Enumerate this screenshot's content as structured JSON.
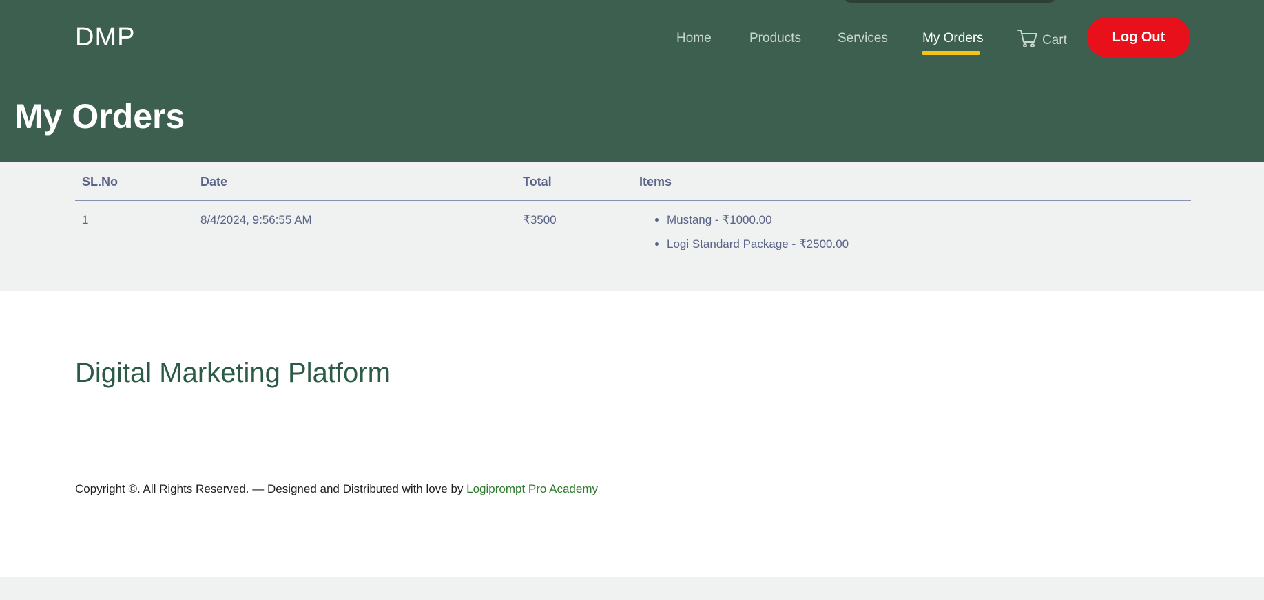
{
  "header": {
    "brand": "DMP",
    "nav": {
      "home": "Home",
      "products": "Products",
      "services": "Services",
      "my_orders": "My Orders",
      "cart": "Cart"
    },
    "logout_label": "Log Out",
    "page_title": "My Orders",
    "colors": {
      "background": "#3d5f50",
      "active_underline": "#f5c315",
      "logout": "#e8101a"
    }
  },
  "orders": {
    "columns": {
      "sl": "SL.No",
      "date": "Date",
      "total": "Total",
      "items": "Items"
    },
    "rows": [
      {
        "sl": "1",
        "date": "8/4/2024, 9:56:55 AM",
        "total": "₹3500",
        "items": [
          "Mustang - ₹1000.00",
          "Logi Standard Package - ₹2500.00"
        ]
      }
    ]
  },
  "footer": {
    "title": "Digital Marketing Platform",
    "copyright_prefix": "Copyright ©. All Rights Reserved. — Designed and Distributed with love by ",
    "copyright_link": "Logiprompt Pro Academy"
  }
}
